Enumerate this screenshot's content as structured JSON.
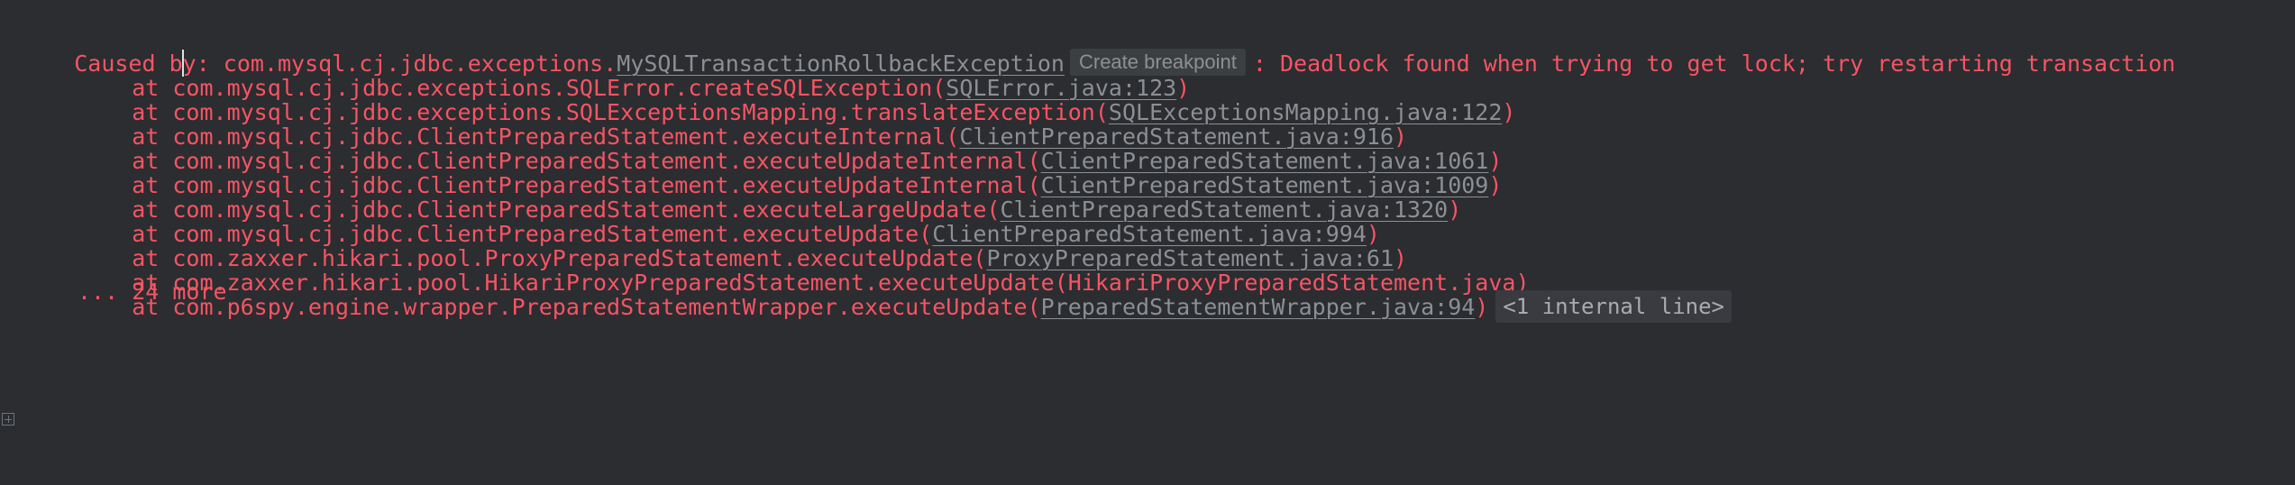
{
  "header": {
    "prefix_a": "Caused b",
    "prefix_b": "y: com.mysql.cj.jdbc.exceptions.",
    "exception_class": "MySQLTransactionRollbackException",
    "breakpoint_label": "Create breakpoint",
    "message": ": Deadlock found when trying to get lock; try restarting transaction"
  },
  "frames": [
    {
      "method": "at com.mysql.cj.jdbc.exceptions.SQLError.createSQLException(",
      "source": "SQLError.java:123",
      "close": ")"
    },
    {
      "method": "at com.mysql.cj.jdbc.exceptions.SQLExceptionsMapping.translateException(",
      "source": "SQLExceptionsMapping.java:122",
      "close": ")"
    },
    {
      "method": "at com.mysql.cj.jdbc.ClientPreparedStatement.executeInternal(",
      "source": "ClientPreparedStatement.java:916",
      "close": ")"
    },
    {
      "method": "at com.mysql.cj.jdbc.ClientPreparedStatement.executeUpdateInternal(",
      "source": "ClientPreparedStatement.java:1061",
      "close": ")"
    },
    {
      "method": "at com.mysql.cj.jdbc.ClientPreparedStatement.executeUpdateInternal(",
      "source": "ClientPreparedStatement.java:1009",
      "close": ")"
    },
    {
      "method": "at com.mysql.cj.jdbc.ClientPreparedStatement.executeLargeUpdate(",
      "source": "ClientPreparedStatement.java:1320",
      "close": ")"
    },
    {
      "method": "at com.mysql.cj.jdbc.ClientPreparedStatement.executeUpdate(",
      "source": "ClientPreparedStatement.java:994",
      "close": ")"
    },
    {
      "method": "at com.zaxxer.hikari.pool.ProxyPreparedStatement.executeUpdate(",
      "source": "ProxyPreparedStatement.java:61",
      "close": ")"
    },
    {
      "method": "at com.zaxxer.hikari.pool.HikariProxyPreparedStatement.executeUpdate(",
      "source": "HikariProxyPreparedStatement.java",
      "close": ")"
    },
    {
      "method": "at com.p6spy.engine.wrapper.PreparedStatementWrapper.executeUpdate(",
      "source": "PreparedStatementWrapper.java:94",
      "close": ")"
    }
  ],
  "internal_lines_label": "<1 internal line>",
  "more_label": "... 24 more",
  "colors": {
    "background": "#2b2d30",
    "error_text": "#f75464",
    "link_text": "#8c8f94",
    "badge_bg": "#393b40"
  },
  "icons": {
    "fold": "fold-expand-icon"
  }
}
